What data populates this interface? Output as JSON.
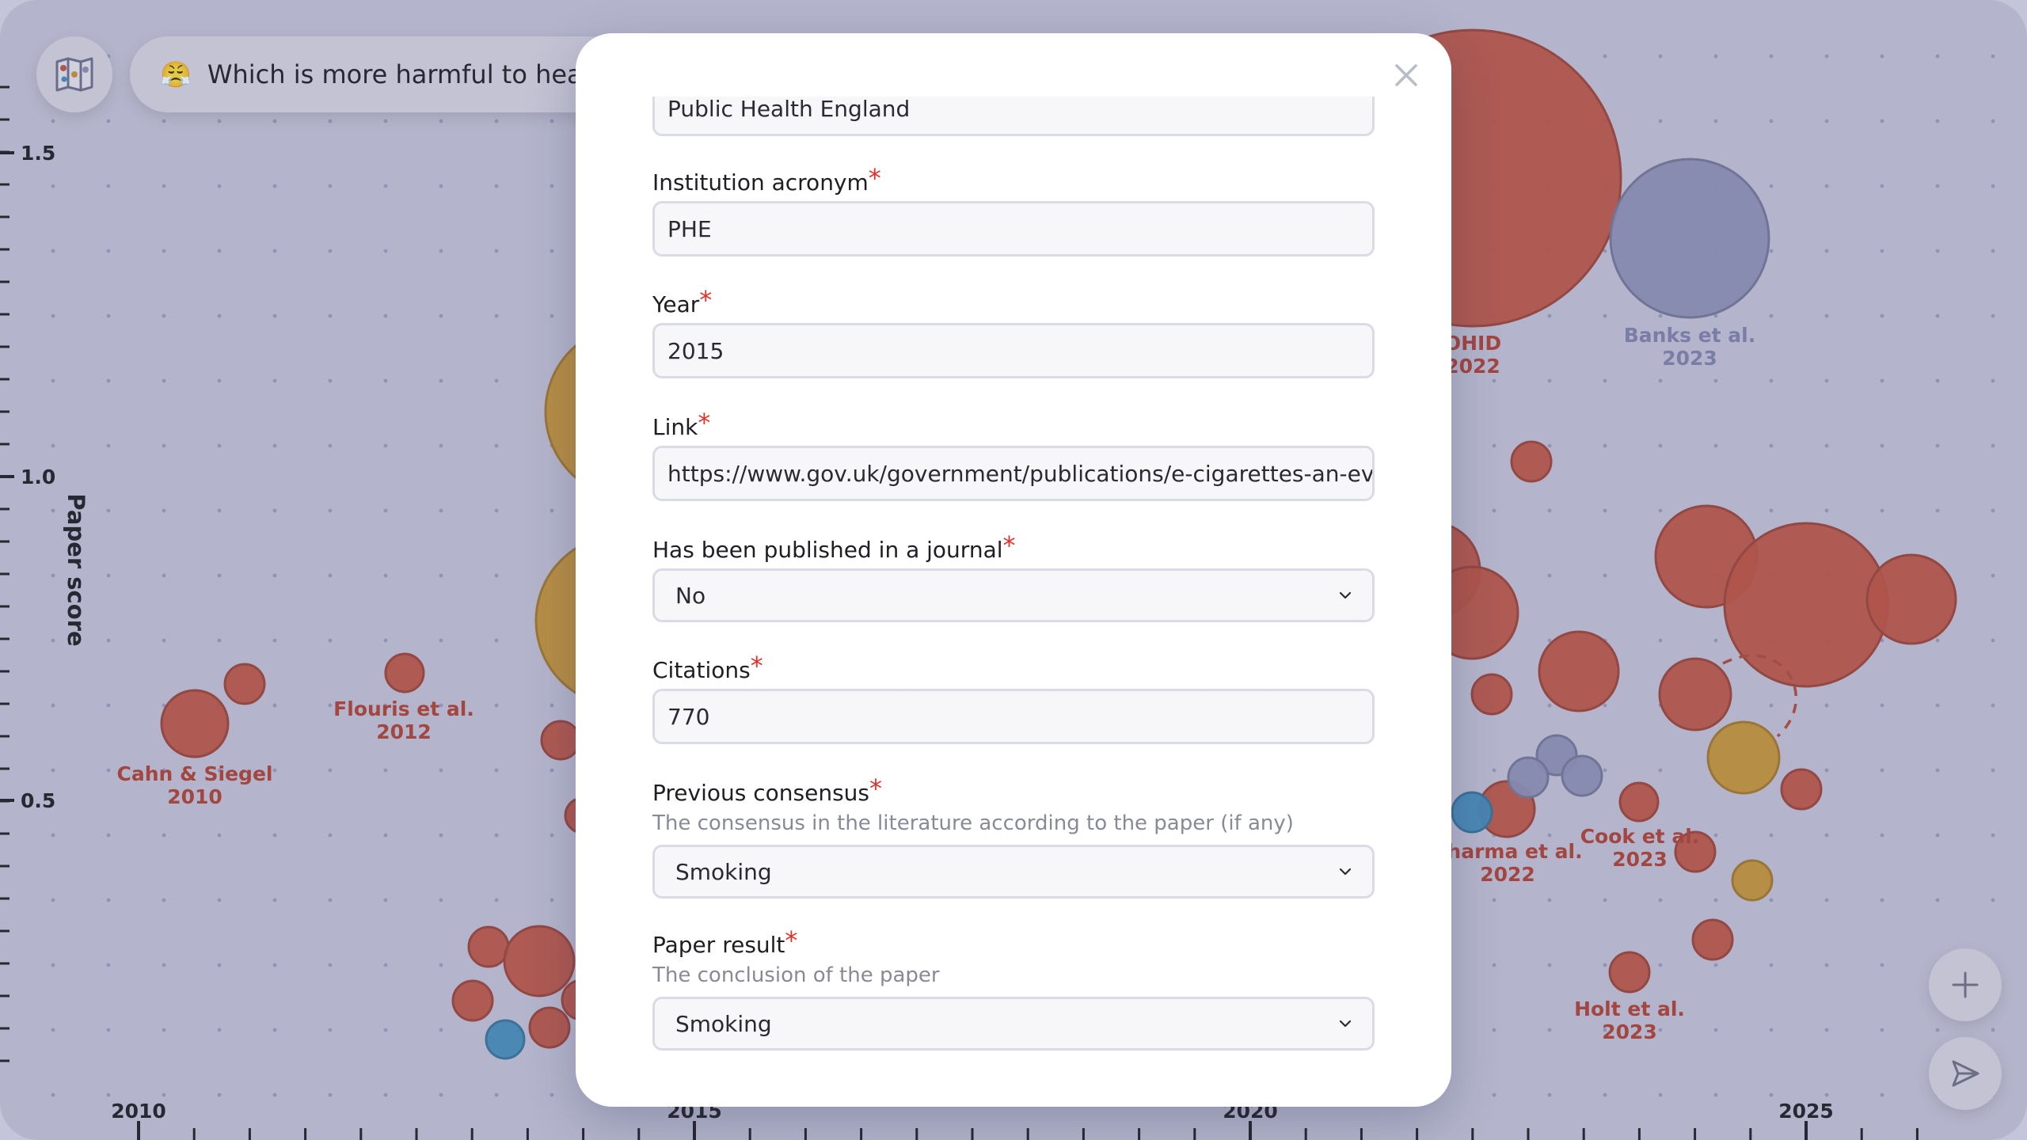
{
  "background_chart": {
    "ylabel": "Paper score",
    "y_ticks": [
      "0.5",
      "1.0",
      "1.5"
    ],
    "x_ticks": [
      "2010",
      "2015",
      "2020",
      "2025"
    ],
    "colors": {
      "red": "#c0523f",
      "orange": "#c9962f",
      "lavender": "#8e92b8",
      "blue": "#3f8fbd"
    },
    "papers": [
      {
        "name": "Cahn & Siegel",
        "year": "2010",
        "color": "red"
      },
      {
        "name": "Flouris et al.",
        "year": "2012",
        "color": "red"
      },
      {
        "name": "OHID",
        "year": "2022",
        "color": "red"
      },
      {
        "name": "Banks et al.",
        "year": "2023",
        "color": "lavender"
      },
      {
        "name": "Sharma et al.",
        "year": "2022",
        "color": "red"
      },
      {
        "name": "Cook et al.",
        "year": "2023",
        "color": "red"
      },
      {
        "name": "Holt et al.",
        "year": "2023",
        "color": "red"
      }
    ]
  },
  "header": {
    "logo_icon": "map-book-icon",
    "question_emoji": "😤",
    "question_text": "Which is more harmful to health:"
  },
  "fabs": {
    "add_icon": "plus-icon",
    "send_icon": "send-icon"
  },
  "modal": {
    "close_icon": "close-icon",
    "fields": {
      "institution_name": {
        "value": "Public Health England"
      },
      "institution_acronym": {
        "label": "Institution acronym",
        "value": "PHE"
      },
      "year": {
        "label": "Year",
        "value": "2015"
      },
      "link": {
        "label": "Link",
        "value": "https://www.gov.uk/government/publications/e-cigarettes-an-evidence-update"
      },
      "published": {
        "label": "Has been published in a journal",
        "value": "No"
      },
      "citations": {
        "label": "Citations",
        "value": "770"
      },
      "previous_consensus": {
        "label": "Previous consensus",
        "help": "The consensus in the literature according to the paper (if any)",
        "value": "Smoking"
      },
      "paper_result": {
        "label": "Paper result",
        "help": "The conclusion of the paper",
        "value": "Smoking"
      }
    },
    "required_marker": "*"
  }
}
